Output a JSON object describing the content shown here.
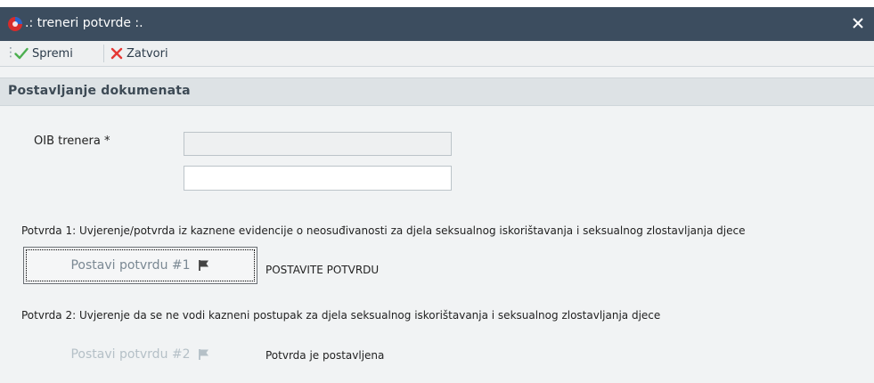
{
  "window": {
    "title": ".: treneri potvrde :.",
    "close_symbol": "✕",
    "app_icon": "app-logo-icon",
    "close_icon": "close-icon"
  },
  "toolbar": {
    "save_label": "Spremi",
    "close_label": "Zatvori",
    "save_icon": "checkmark-icon",
    "close_icon": "x-icon"
  },
  "section": {
    "title": "Postavljanje dokumenata"
  },
  "form": {
    "oib_label": "OIB trenera *",
    "oib_value": "",
    "oib_second_value": ""
  },
  "potvrda1": {
    "description": "Potvrda 1: Uvjerenje/potvrda iz kaznene evidencije o neosuđivanosti za djela seksualnog iskorištavanja i seksualnog zlostavljanja djece",
    "button_label": "Postavi potvrdu #1",
    "flag_icon": "flag-icon",
    "status": "POSTAVITE POTVRDU"
  },
  "potvrda2": {
    "description": "Potvrda 2: Uvjerenje da se ne vodi kazneni postupak za djela seksualnog iskorištavanja i seksualnog zlostavljanja djece",
    "button_label": "Postavi potvrdu #2",
    "flag_icon": "flag-icon",
    "status": "Potvrda je postavljena"
  },
  "colors": {
    "titlebar": "#3c4d5f",
    "save_check": "#4caf50",
    "close_x": "#e53935",
    "section_header": "#dde2e5"
  }
}
